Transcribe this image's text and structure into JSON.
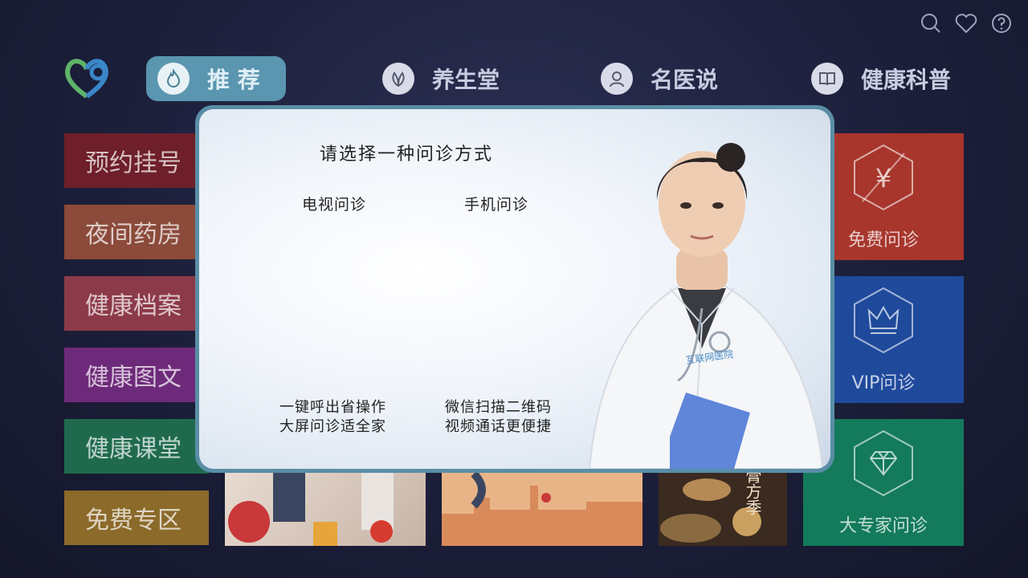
{
  "top_icons": [
    "search-icon",
    "heart-icon",
    "help-icon"
  ],
  "nav": [
    {
      "label": "推 荐",
      "icon": "flame-icon",
      "active": true
    },
    {
      "label": "养生堂",
      "icon": "leaf-icon",
      "active": false
    },
    {
      "label": "名医说",
      "icon": "doctor-icon",
      "active": false
    },
    {
      "label": "健康科普",
      "icon": "book-icon",
      "active": false
    }
  ],
  "side_tiles": [
    {
      "label": "预约挂号",
      "color": "#6e1f2a"
    },
    {
      "label": "夜间药房",
      "color": "#8b4a3a"
    },
    {
      "label": "健康档案",
      "color": "#8c3a4a"
    },
    {
      "label": "健康图文",
      "color": "#6e2a7a"
    },
    {
      "label": "健康课堂",
      "color": "#1f6a4e"
    },
    {
      "label": "免费专区",
      "color": "#8b6a2a"
    }
  ],
  "right_tiles": [
    {
      "label": "免费问诊",
      "icon": "yen-hexagon-icon",
      "color": "#b3392e"
    },
    {
      "label": "VIP问诊",
      "icon": "crown-hexagon-icon",
      "color": "#1e4aa0"
    },
    {
      "label": "大专家问诊",
      "icon": "diamond-hexagon-icon",
      "color": "#137a5a"
    }
  ],
  "banner_texts": {
    "calligraphy": "膏方季"
  },
  "modal": {
    "title": "请选择一种问诊方式",
    "options": [
      {
        "label": "电视问诊",
        "desc": [
          "一键呼出省操作",
          "大屏问诊适全家"
        ]
      },
      {
        "label": "手机问诊",
        "desc": [
          "微信扫描二维码",
          "视频通话更便捷"
        ]
      }
    ],
    "badge": "互联网医院"
  },
  "colors": {
    "accent": "#5a96b0",
    "modal_border": "#5a8ea6"
  }
}
